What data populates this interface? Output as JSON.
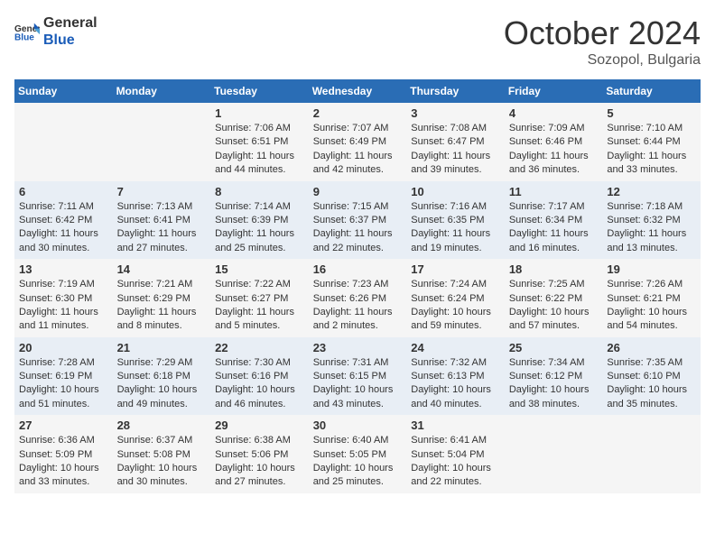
{
  "header": {
    "logo_general": "General",
    "logo_blue": "Blue",
    "month": "October 2024",
    "location": "Sozopol, Bulgaria"
  },
  "weekdays": [
    "Sunday",
    "Monday",
    "Tuesday",
    "Wednesday",
    "Thursday",
    "Friday",
    "Saturday"
  ],
  "weeks": [
    [
      {
        "day": "",
        "info": ""
      },
      {
        "day": "",
        "info": ""
      },
      {
        "day": "1",
        "sunrise": "7:06 AM",
        "sunset": "6:51 PM",
        "daylight": "11 hours and 44 minutes."
      },
      {
        "day": "2",
        "sunrise": "7:07 AM",
        "sunset": "6:49 PM",
        "daylight": "11 hours and 42 minutes."
      },
      {
        "day": "3",
        "sunrise": "7:08 AM",
        "sunset": "6:47 PM",
        "daylight": "11 hours and 39 minutes."
      },
      {
        "day": "4",
        "sunrise": "7:09 AM",
        "sunset": "6:46 PM",
        "daylight": "11 hours and 36 minutes."
      },
      {
        "day": "5",
        "sunrise": "7:10 AM",
        "sunset": "6:44 PM",
        "daylight": "11 hours and 33 minutes."
      }
    ],
    [
      {
        "day": "6",
        "sunrise": "7:11 AM",
        "sunset": "6:42 PM",
        "daylight": "11 hours and 30 minutes."
      },
      {
        "day": "7",
        "sunrise": "7:13 AM",
        "sunset": "6:41 PM",
        "daylight": "11 hours and 27 minutes."
      },
      {
        "day": "8",
        "sunrise": "7:14 AM",
        "sunset": "6:39 PM",
        "daylight": "11 hours and 25 minutes."
      },
      {
        "day": "9",
        "sunrise": "7:15 AM",
        "sunset": "6:37 PM",
        "daylight": "11 hours and 22 minutes."
      },
      {
        "day": "10",
        "sunrise": "7:16 AM",
        "sunset": "6:35 PM",
        "daylight": "11 hours and 19 minutes."
      },
      {
        "day": "11",
        "sunrise": "7:17 AM",
        "sunset": "6:34 PM",
        "daylight": "11 hours and 16 minutes."
      },
      {
        "day": "12",
        "sunrise": "7:18 AM",
        "sunset": "6:32 PM",
        "daylight": "11 hours and 13 minutes."
      }
    ],
    [
      {
        "day": "13",
        "sunrise": "7:19 AM",
        "sunset": "6:30 PM",
        "daylight": "11 hours and 11 minutes."
      },
      {
        "day": "14",
        "sunrise": "7:21 AM",
        "sunset": "6:29 PM",
        "daylight": "11 hours and 8 minutes."
      },
      {
        "day": "15",
        "sunrise": "7:22 AM",
        "sunset": "6:27 PM",
        "daylight": "11 hours and 5 minutes."
      },
      {
        "day": "16",
        "sunrise": "7:23 AM",
        "sunset": "6:26 PM",
        "daylight": "11 hours and 2 minutes."
      },
      {
        "day": "17",
        "sunrise": "7:24 AM",
        "sunset": "6:24 PM",
        "daylight": "10 hours and 59 minutes."
      },
      {
        "day": "18",
        "sunrise": "7:25 AM",
        "sunset": "6:22 PM",
        "daylight": "10 hours and 57 minutes."
      },
      {
        "day": "19",
        "sunrise": "7:26 AM",
        "sunset": "6:21 PM",
        "daylight": "10 hours and 54 minutes."
      }
    ],
    [
      {
        "day": "20",
        "sunrise": "7:28 AM",
        "sunset": "6:19 PM",
        "daylight": "10 hours and 51 minutes."
      },
      {
        "day": "21",
        "sunrise": "7:29 AM",
        "sunset": "6:18 PM",
        "daylight": "10 hours and 49 minutes."
      },
      {
        "day": "22",
        "sunrise": "7:30 AM",
        "sunset": "6:16 PM",
        "daylight": "10 hours and 46 minutes."
      },
      {
        "day": "23",
        "sunrise": "7:31 AM",
        "sunset": "6:15 PM",
        "daylight": "10 hours and 43 minutes."
      },
      {
        "day": "24",
        "sunrise": "7:32 AM",
        "sunset": "6:13 PM",
        "daylight": "10 hours and 40 minutes."
      },
      {
        "day": "25",
        "sunrise": "7:34 AM",
        "sunset": "6:12 PM",
        "daylight": "10 hours and 38 minutes."
      },
      {
        "day": "26",
        "sunrise": "7:35 AM",
        "sunset": "6:10 PM",
        "daylight": "10 hours and 35 minutes."
      }
    ],
    [
      {
        "day": "27",
        "sunrise": "6:36 AM",
        "sunset": "5:09 PM",
        "daylight": "10 hours and 33 minutes."
      },
      {
        "day": "28",
        "sunrise": "6:37 AM",
        "sunset": "5:08 PM",
        "daylight": "10 hours and 30 minutes."
      },
      {
        "day": "29",
        "sunrise": "6:38 AM",
        "sunset": "5:06 PM",
        "daylight": "10 hours and 27 minutes."
      },
      {
        "day": "30",
        "sunrise": "6:40 AM",
        "sunset": "5:05 PM",
        "daylight": "10 hours and 25 minutes."
      },
      {
        "day": "31",
        "sunrise": "6:41 AM",
        "sunset": "5:04 PM",
        "daylight": "10 hours and 22 minutes."
      },
      {
        "day": "",
        "info": ""
      },
      {
        "day": "",
        "info": ""
      }
    ]
  ],
  "labels": {
    "sunrise": "Sunrise:",
    "sunset": "Sunset:",
    "daylight": "Daylight:"
  }
}
